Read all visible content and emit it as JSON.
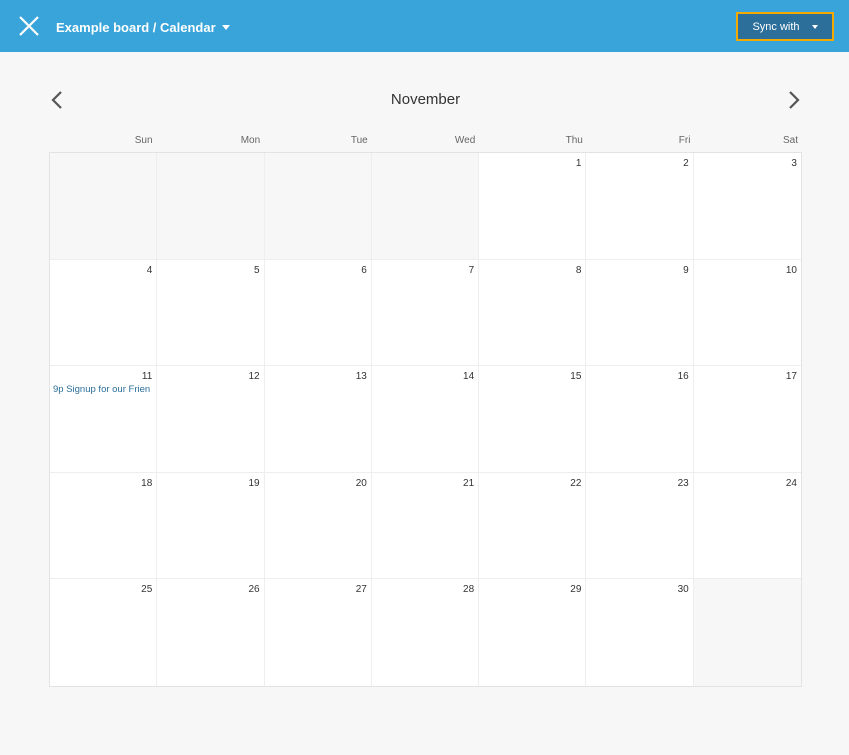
{
  "header": {
    "board_title": "Example board / Calendar",
    "sync_label": "Sync with"
  },
  "calendar": {
    "month": "November",
    "weekdays": [
      "Sun",
      "Mon",
      "Tue",
      "Wed",
      "Thu",
      "Fri",
      "Sat"
    ],
    "days": [
      "",
      "",
      "",
      "",
      "1",
      "2",
      "3",
      "4",
      "5",
      "6",
      "7",
      "8",
      "9",
      "10",
      "11",
      "12",
      "13",
      "14",
      "15",
      "16",
      "17",
      "18",
      "19",
      "20",
      "21",
      "22",
      "23",
      "24",
      "25",
      "26",
      "27",
      "28",
      "29",
      "30",
      ""
    ],
    "events": [
      {
        "day": "11",
        "label": "9p Signup for our Frien"
      }
    ]
  },
  "icons": {
    "close": "close-icon",
    "prev": "chevron-left-icon",
    "next": "chevron-right-icon"
  },
  "colors": {
    "header_bg": "#39a4d9",
    "sync_bg": "#2b6f9a",
    "sync_border": "#f2a900",
    "event_text": "#2b6f9a"
  }
}
